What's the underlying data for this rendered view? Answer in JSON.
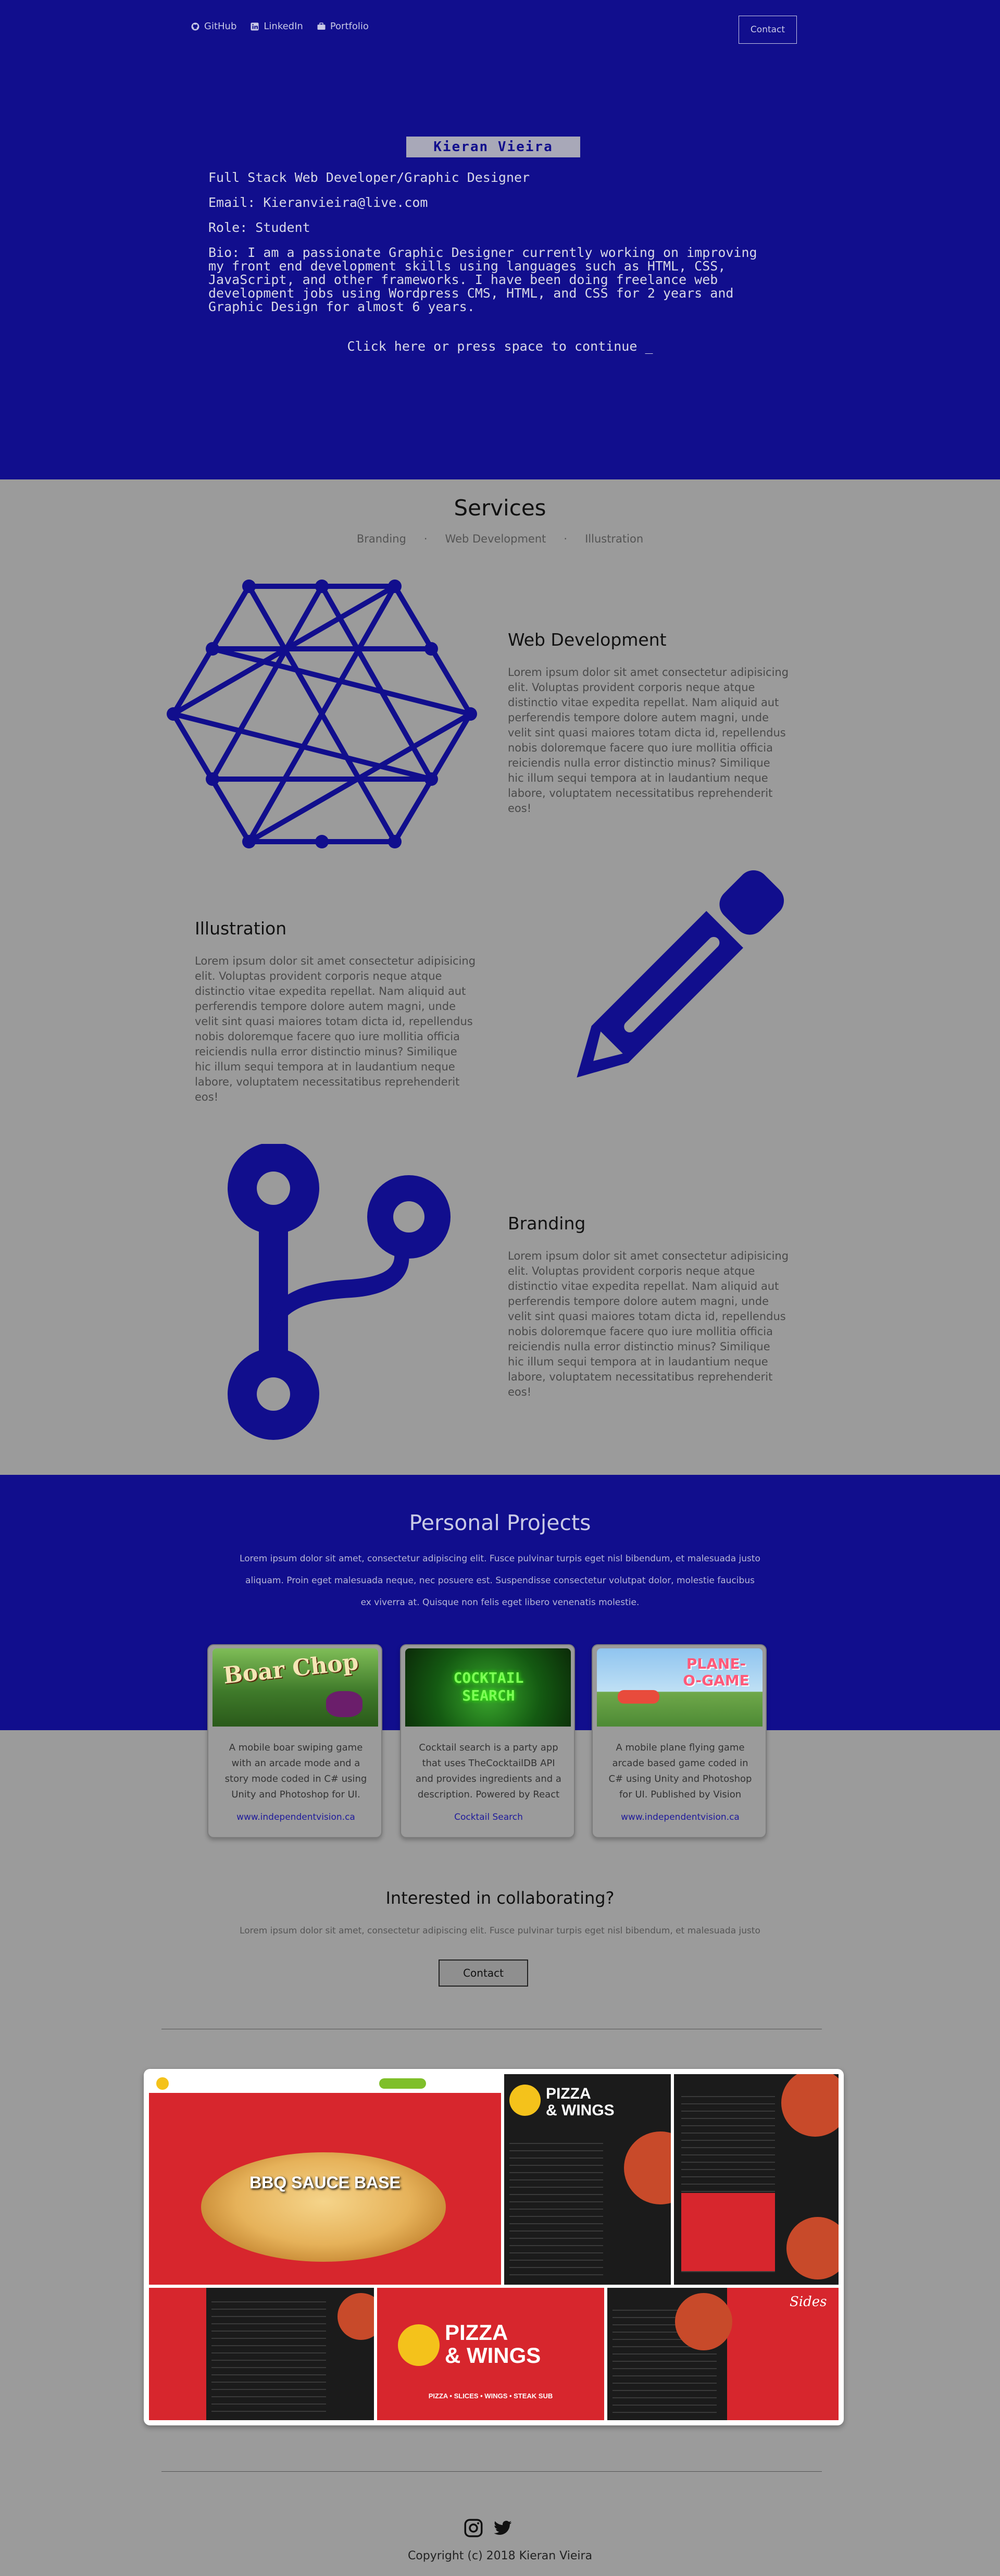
{
  "nav": {
    "links": [
      {
        "label": "GitHub",
        "icon": "github-icon"
      },
      {
        "label": "LinkedIn",
        "icon": "linkedin-icon"
      },
      {
        "label": "Portfolio",
        "icon": "briefcase-icon"
      }
    ],
    "contact_label": "Contact"
  },
  "hero": {
    "name": "Kieran Vieira",
    "role_line": "Full Stack Web Developer/Graphic Designer",
    "email": "Email: Kieranvieira@live.com",
    "role": "Role: Student",
    "bio": "Bio: I am a passionate Graphic Designer currently working on improving my front end development skills using languages such as HTML, CSS, JavaScript, and other frameworks. I have been doing freelance web development jobs using Wordpress CMS, HTML, and CSS for 2 years and Graphic Design for almost 6 years.",
    "continue": "Click here or press space to continue _"
  },
  "services": {
    "title": "Services",
    "tabs": [
      "Branding",
      "Web Development",
      "Illustration"
    ],
    "separator": "·",
    "items": [
      {
        "title": "Web Development",
        "text": "Lorem ipsum dolor sit amet consectetur adipisicing elit. Voluptas provident corporis neque atque distinctio vitae expedita repellat. Nam aliquid aut perferendis tempore dolore autem magni, unde velit sint quasi maiores totam dicta id, repellendus nobis doloremque facere quo iure mollitia officia reiciendis nulla error distinctio minus? Similique hic illum sequi tempora at in laudantium neque labore, voluptatem necessitatibus reprehenderit eos!",
        "icon": "network-hexagon-icon"
      },
      {
        "title": "Illustration",
        "text": "Lorem ipsum dolor sit amet consectetur adipisicing elit. Voluptas provident corporis neque atque distinctio vitae expedita repellat. Nam aliquid aut perferendis tempore dolore autem magni, unde velit sint quasi maiores totam dicta id, repellendus nobis doloremque facere quo iure mollitia officia reiciendis nulla error distinctio minus? Similique hic illum sequi tempora at in laudantium neque labore, voluptatem necessitatibus reprehenderit eos!",
        "icon": "pencil-icon"
      },
      {
        "title": "Branding",
        "text": "Lorem ipsum dolor sit amet consectetur adipisicing elit. Voluptas provident corporis neque atque distinctio vitae expedita repellat. Nam aliquid aut perferendis tempore dolore autem magni, unde velit sint quasi maiores totam dicta id, repellendus nobis doloremque facere quo iure mollitia officia reiciendis nulla error distinctio minus? Similique hic illum sequi tempora at in laudantium neque labore, voluptatem necessitatibus reprehenderit eos!",
        "icon": "code-branch-icon"
      }
    ]
  },
  "projects": {
    "title": "Personal Projects",
    "description": "Lorem ipsum dolor sit amet, consectetur adipiscing elit. Fusce pulvinar turpis eget nisl bibendum, et malesuada justo aliquam. Proin eget malesuada neque, nec posuere est. Suspendisse consectetur volutpat dolor, molestie faucibus ex viverra at. Quisque non felis eget libero venenatis molestie.",
    "cards": [
      {
        "image_text": "Boar Chop",
        "text": "A mobile boar swiping game with an arcade mode and a story mode coded in C# using Unity and Photoshop for UI.",
        "link": "www.independentvision.ca"
      },
      {
        "image_text": "COCKTAIL SEARCH",
        "text": "Cocktail search is a party app that uses TheCocktailDB API and provides ingredients and a description. Powered by React",
        "link": "Cocktail Search"
      },
      {
        "image_text": "PLANE-O-GAME",
        "text": "A mobile plane flying game arcade based game coded in C# using Unity and Photoshop for UI. Published by Vision",
        "link": "www.independentvision.ca"
      }
    ]
  },
  "collab": {
    "title": "Interested in collaborating?",
    "text": "Lorem ipsum dolor sit amet, consectetur adipiscing elit. Fusce pulvinar turpis eget nisl bibendum, et malesuada justo",
    "button": "Contact"
  },
  "showcase": {
    "brand_line1": "PIZZA",
    "brand_line2": "& WINGS",
    "hero_text": "BBQ SAUCE BASE",
    "banner_nav": "PIZZA  •  SLICES  •  WINGS  •  STEAK SUB",
    "sides_label": "Sides"
  },
  "footer": {
    "copyright": "Copyright (c) 2018 Kieran Vieira",
    "icons": [
      "instagram-icon",
      "twitter-icon"
    ]
  },
  "colors": {
    "primary": "#110e8d",
    "background": "#9b9b9b",
    "pizza_red": "#d7262d"
  }
}
